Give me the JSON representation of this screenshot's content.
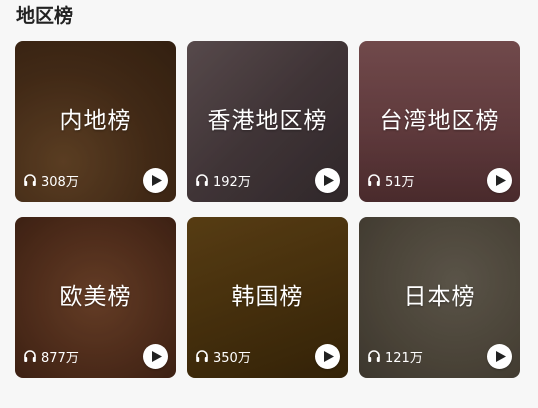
{
  "section": {
    "title": "地区榜"
  },
  "cards": [
    {
      "title": "内地榜",
      "plays": "308万",
      "color": "#5a3a1f"
    },
    {
      "title": "香港地区榜",
      "plays": "192万",
      "color": "#5a4a4c"
    },
    {
      "title": "台湾地区榜",
      "plays": "51万",
      "color": "#7a4a4c"
    },
    {
      "title": "欧美榜",
      "plays": "877万",
      "color": "#6a3a22"
    },
    {
      "title": "韩国榜",
      "plays": "350万",
      "color": "#5a3c10"
    },
    {
      "title": "日本榜",
      "plays": "121万",
      "color": "#5f574a"
    }
  ],
  "icons": {
    "listen": "headphones-icon",
    "play": "play-icon"
  }
}
